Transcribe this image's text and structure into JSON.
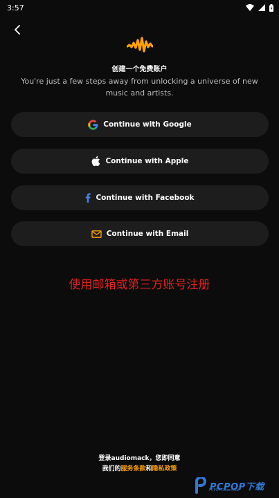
{
  "status_bar": {
    "time": "3:57"
  },
  "header": {
    "title": "创建一个免费账户",
    "subtitle": "You're just a few steps away from unlocking a universe of new music and artists."
  },
  "buttons": {
    "google": "Continue with Google",
    "apple": "Continue with Apple",
    "facebook": "Continue with Facebook",
    "email": "Continue with Email"
  },
  "annotation": "使用邮箱或第三方账号注册",
  "terms": {
    "line1": "登录audiomack，您即同意",
    "prefix": "我们的",
    "terms_link": "服务条款",
    "and": "和",
    "privacy_link": "隐私政策"
  },
  "watermark": {
    "text": "PCPOP下载",
    "sub": "PCPOP Download"
  },
  "colors": {
    "accent": "#ffa200",
    "background": "#0c0c0c",
    "button": "#1d1d1d",
    "annotation": "#e02020"
  }
}
